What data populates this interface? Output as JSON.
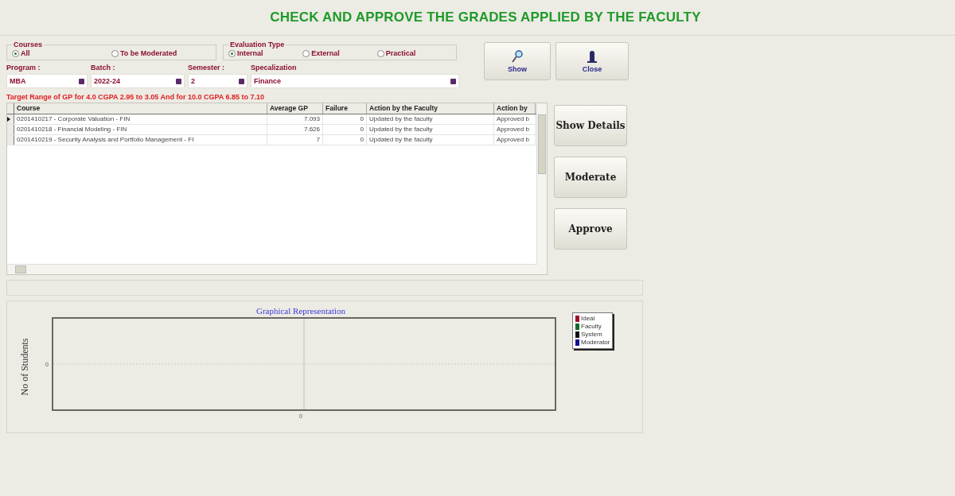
{
  "title": "CHECK AND APPROVE THE GRADES APPLIED BY THE FACULTY",
  "courses": {
    "label": "Courses",
    "options": [
      {
        "label": "All",
        "selected": true
      },
      {
        "label": "To be Moderated",
        "selected": false
      }
    ]
  },
  "evaluation_type": {
    "label": "Evaluation Type",
    "options": [
      {
        "label": "Internal",
        "selected": true
      },
      {
        "label": "External",
        "selected": false
      },
      {
        "label": "Practical",
        "selected": false
      }
    ]
  },
  "filters": [
    {
      "label": "Program :",
      "value": "MBA"
    },
    {
      "label": "Batch :",
      "value": "2022-24"
    },
    {
      "label": "Semester :",
      "value": "2"
    },
    {
      "label": "Specalization",
      "value": "Finance"
    }
  ],
  "top_buttons": [
    {
      "kind": "search",
      "label": "Show"
    },
    {
      "kind": "close",
      "label": "Close"
    }
  ],
  "target_note": "Target Range of GP for 4.0 CGPA 2.95 to 3.05 And for 10.0 CGPA 6.85 to 7.10",
  "table": {
    "columns": [
      "Course",
      "Average GP",
      "Failure",
      "Action by the Faculty",
      "Action by"
    ],
    "rows": [
      {
        "selected": true,
        "cells": [
          "0201410217 - Corporate Valuation - FIN",
          "7.093",
          "0",
          "Updated by the faculty",
          "Approved b"
        ]
      },
      {
        "selected": false,
        "cells": [
          "0201410218 - Financial Modeling - FIN",
          "7.626",
          "0",
          "Updated by the faculty",
          "Approved b"
        ]
      },
      {
        "selected": false,
        "cells": [
          "0201410219 - Security Analysis and Portfolio Management - FI",
          "7",
          "0",
          "Updated by the faculty",
          "Approved b"
        ]
      }
    ]
  },
  "side_buttons": [
    "Show Details",
    "Moderate",
    "Approve"
  ],
  "graph": {
    "title": "Graphical Representation",
    "ylabel": "No of Students",
    "ytick": "0",
    "xtick": "0",
    "legend": [
      {
        "name": "Ideal",
        "color": "#a0102a"
      },
      {
        "name": "Faculty",
        "color": "#0a6a2a"
      },
      {
        "name": "System",
        "color": "#101010"
      },
      {
        "name": "Moderator",
        "color": "#101090"
      }
    ]
  }
}
